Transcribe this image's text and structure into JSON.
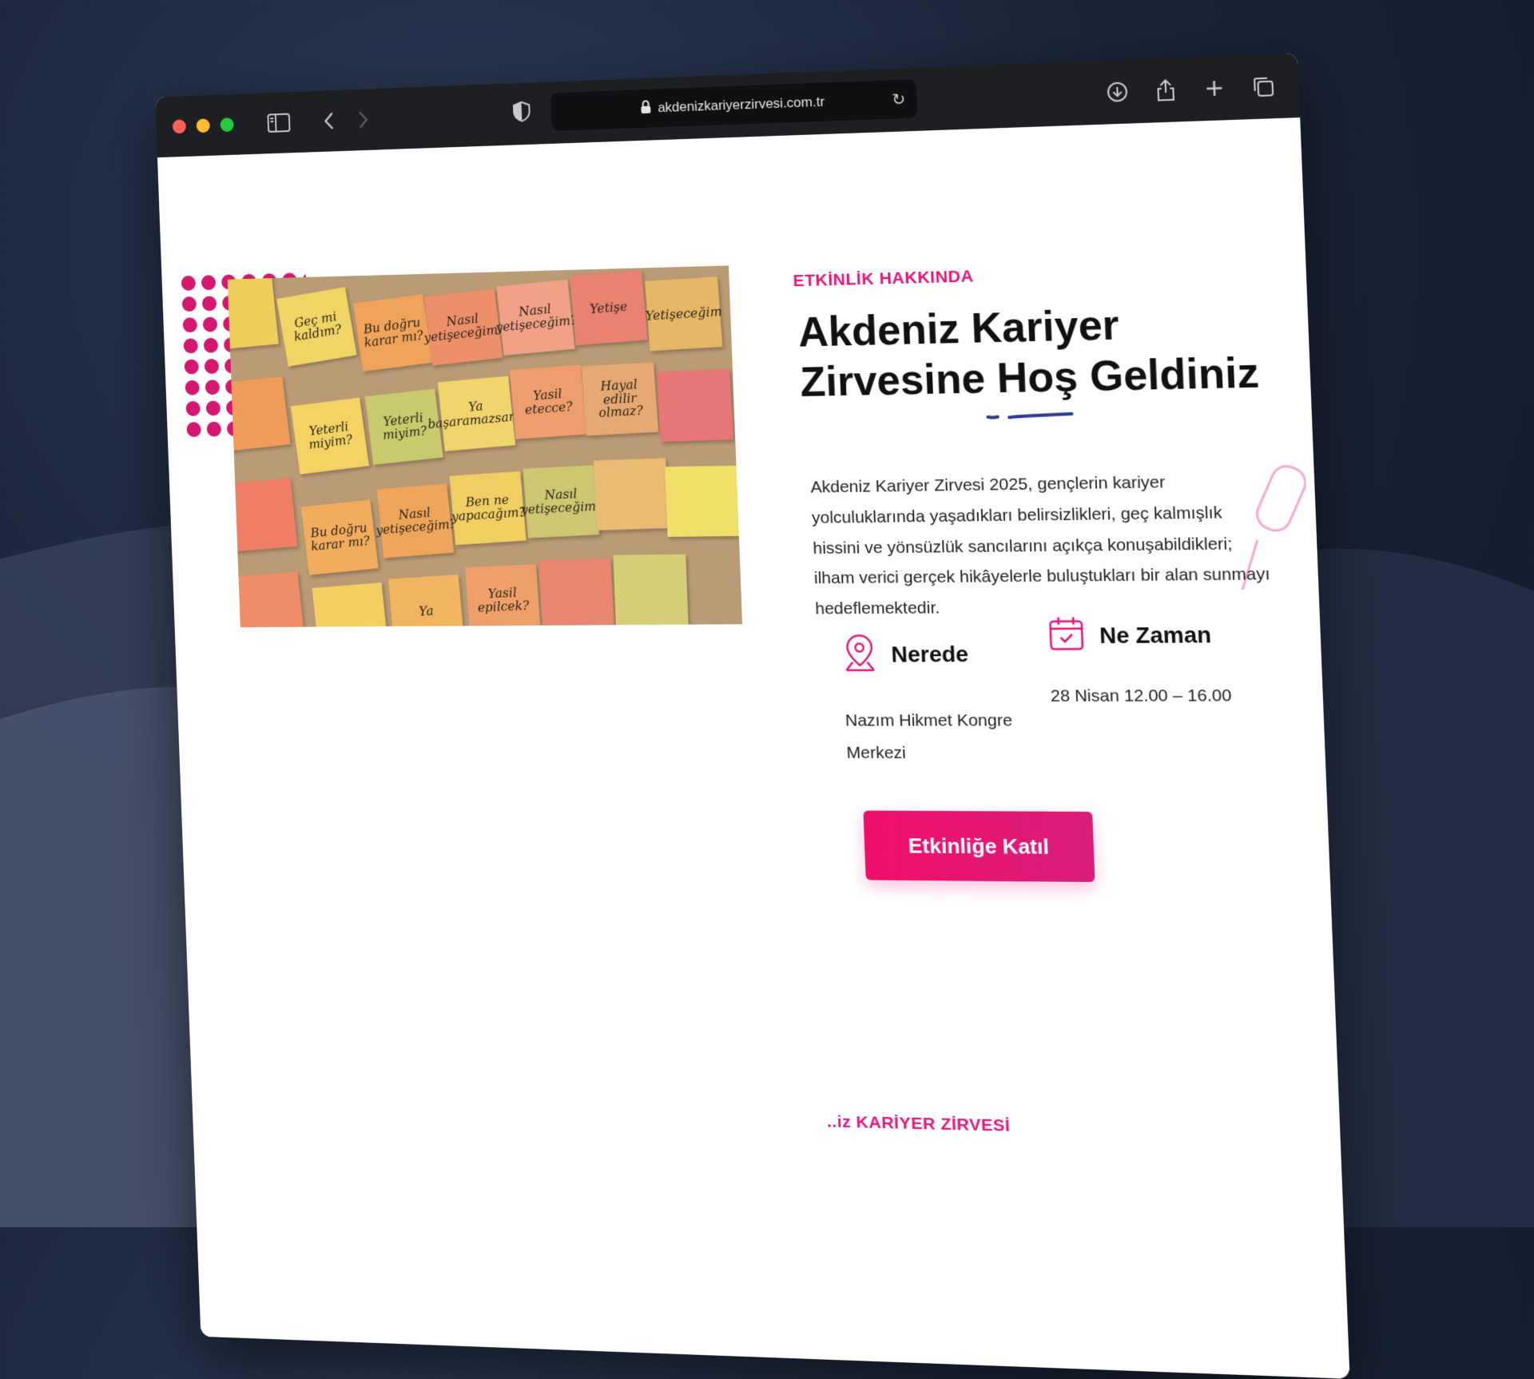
{
  "browser": {
    "url": "akdenizkariyerzirvesi.com.tr",
    "icons": [
      "sidebar-icon",
      "back-icon",
      "forward-icon",
      "shield-icon",
      "lock-icon",
      "reload-icon",
      "download-icon",
      "share-icon",
      "new-tab-icon",
      "tabs-overview-icon"
    ]
  },
  "about": {
    "eyebrow": "ETKİNLİK HAKKINDA",
    "title_line1": "Akdeniz Kariyer",
    "title_line2a": "Zirvesine ",
    "title_line2b": "Hoş",
    "title_line2c": " Geldiniz",
    "description": "Akdeniz Kariyer Zirvesi 2025, gençlerin kariyer yolculuklarında yaşadıkları belirsizlikleri, geç kalmışlık hissini ve yönsüzlük sancılarını açıkça konuşabildikleri; ilham verici gerçek hikâyelerle buluştukları bir alan sunmayı hedeflemektedir.",
    "where_title": "Nerede",
    "where_value": "Nazım Hikmet Kongre Merkezi",
    "when_title": "Ne Zaman",
    "when_value": "28 Nisan 12.00 – 16.00",
    "cta_label": "Etkinliğe Katıl"
  },
  "photo_notes": [
    "Geç mi kaldım?",
    "Bu doğru karar mı?",
    "Nasıl yetişeceğim?",
    "Nasıl yetişeceğim?",
    "Yetişe",
    "Ya başaramazsam?",
    "Yetişeceğim",
    "Yeterli miyim?",
    "Yeterli miyim?",
    "Ya başaramazsam?",
    "Yasil etecce?",
    "Hayal edilir olmaz?",
    "Ben ne yapacağım?",
    "Bu doğru karar mı?",
    "Nasıl yetişeceğim?",
    "Nasıl yetişeceğim?",
    "Yasil epilcek?",
    "Ya"
  ],
  "footer_eyebrow": "..iz KARİYER ZİRVESİ",
  "colors": {
    "accent": "#e6157a",
    "underline": "#2b3a8f"
  }
}
